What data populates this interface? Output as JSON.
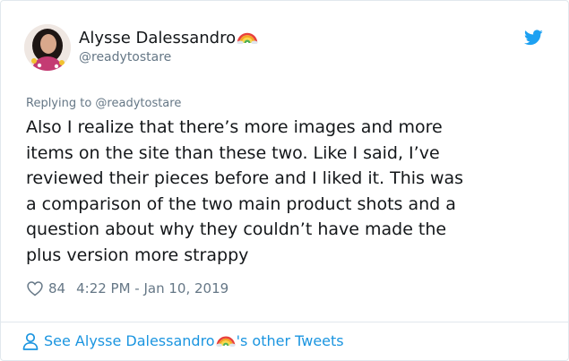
{
  "tweet": {
    "author_name": "Alysse Dalessandro",
    "author_handle": "@readytostare",
    "replying_to": "Replying to @readytostare",
    "text": "Also I realize that there’s more images and more\nitems on the site than these two. Like I said, I’ve\nreviewed their pieces before and I liked it. This was\na comparison of the two main product shots and a\nquestion about why they couldn’t have made the\nplus version more strappy",
    "likes": "84",
    "timestamp": "4:22 PM - Jan 10, 2019"
  },
  "footer": {
    "link_prefix": "See Alysse Dalessandro",
    "link_suffix": "'s other Tweets"
  },
  "colors": {
    "link_blue": "#1b95e0",
    "twitter_blue": "#1da1f2",
    "secondary_text": "#657786"
  },
  "icons": [
    "rainbow-emoji",
    "twitter-bird-icon",
    "heart-icon",
    "person-icon"
  ]
}
